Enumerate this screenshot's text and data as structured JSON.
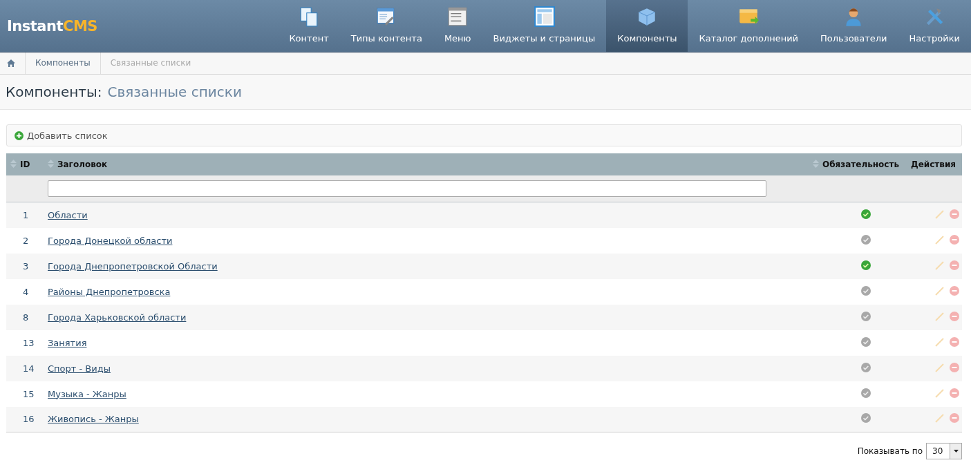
{
  "logo": {
    "part1": "Instant",
    "part2": "CMS"
  },
  "nav": [
    {
      "label": "Контент",
      "selected": false
    },
    {
      "label": "Типы контента",
      "selected": false
    },
    {
      "label": "Меню",
      "selected": false
    },
    {
      "label": "Виджеты и страницы",
      "selected": false
    },
    {
      "label": "Компоненты",
      "selected": true
    },
    {
      "label": "Каталог дополнений",
      "selected": false
    },
    {
      "label": "Пользователи",
      "selected": false
    },
    {
      "label": "Настройки",
      "selected": false
    }
  ],
  "breadcrumbs": [
    {
      "label": "Компоненты",
      "current": false
    },
    {
      "label": "Связанные списки",
      "current": true
    }
  ],
  "heading": {
    "prefix": "Компоненты:",
    "title": "Связанные списки"
  },
  "toolbar": {
    "add_button": "Добавить список"
  },
  "table": {
    "columns": [
      {
        "label": "ID",
        "sortable": true
      },
      {
        "label": "Заголовок",
        "sortable": true
      },
      {
        "label": "Обязательность",
        "sortable": true
      },
      {
        "label": "Действия",
        "sortable": false
      }
    ],
    "rows": [
      {
        "id": "1",
        "title": "Области",
        "required": true
      },
      {
        "id": "2",
        "title": "Города Донецкой области",
        "required": false
      },
      {
        "id": "3",
        "title": "Города Днепропетровской Области",
        "required": true
      },
      {
        "id": "4",
        "title": "Районы Днепропетровска",
        "required": false
      },
      {
        "id": "8",
        "title": "Города Харьковской области",
        "required": false
      },
      {
        "id": "13",
        "title": "Занятия",
        "required": false
      },
      {
        "id": "14",
        "title": "Спорт - Виды",
        "required": false
      },
      {
        "id": "15",
        "title": "Музыка - Жанры",
        "required": false
      },
      {
        "id": "16",
        "title": "Живопись - Жанры",
        "required": false
      }
    ]
  },
  "pager": {
    "label": "Показывать по",
    "per_page": "30"
  }
}
